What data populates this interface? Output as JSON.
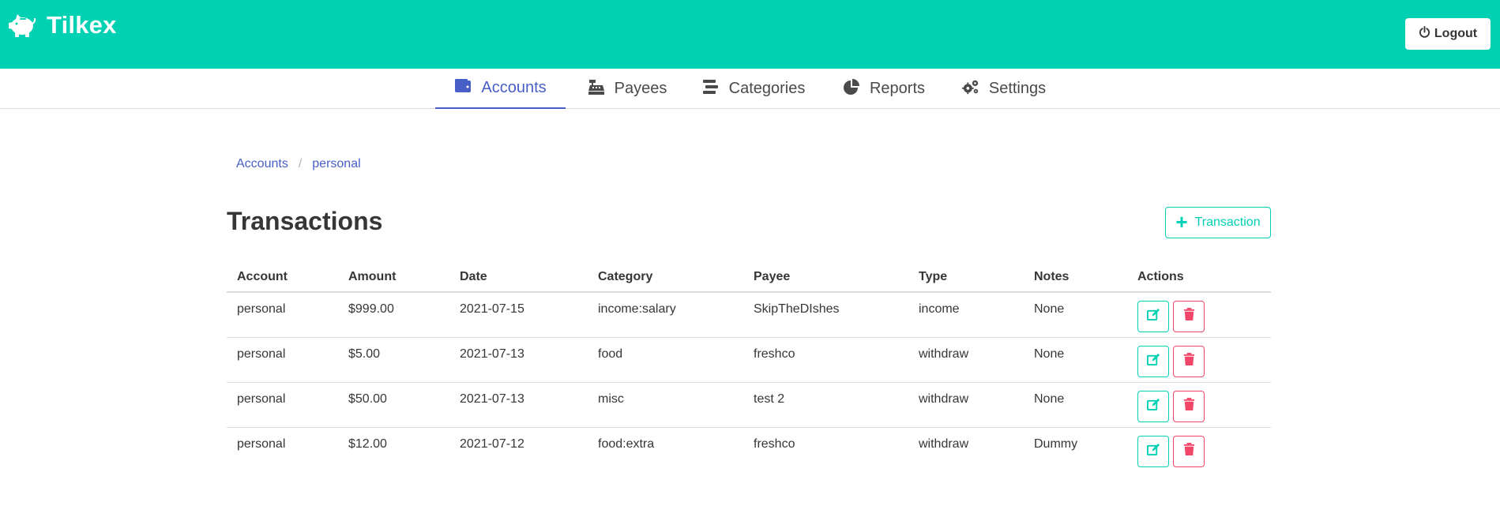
{
  "app": {
    "name": "Tilkex",
    "logo_icon": "piggy-bank-icon"
  },
  "header": {
    "logout_label": "Logout",
    "logout_icon": "power-icon"
  },
  "nav": {
    "tabs": [
      {
        "label": "Accounts",
        "icon": "wallet-icon",
        "active": true
      },
      {
        "label": "Payees",
        "icon": "cash-register-icon",
        "active": false
      },
      {
        "label": "Categories",
        "icon": "stream-icon",
        "active": false
      },
      {
        "label": "Reports",
        "icon": "chart-pie-icon",
        "active": false
      },
      {
        "label": "Settings",
        "icon": "cogs-icon",
        "active": false
      }
    ]
  },
  "breadcrumb": {
    "items": [
      "Accounts",
      "personal"
    ],
    "separator": "/"
  },
  "page": {
    "title": "Transactions",
    "add_button_label": "Transaction"
  },
  "table": {
    "columns": [
      "Account",
      "Amount",
      "Date",
      "Category",
      "Payee",
      "Type",
      "Notes",
      "Actions"
    ],
    "rows": [
      {
        "account": "personal",
        "amount": "$999.00",
        "date": "2021-07-15",
        "category": "income:salary",
        "payee": "SkipTheDIshes",
        "type": "income",
        "notes": "None"
      },
      {
        "account": "personal",
        "amount": "$5.00",
        "date": "2021-07-13",
        "category": "food",
        "payee": "freshco",
        "type": "withdraw",
        "notes": "None"
      },
      {
        "account": "personal",
        "amount": "$50.00",
        "date": "2021-07-13",
        "category": "misc",
        "payee": "test 2",
        "type": "withdraw",
        "notes": "None"
      },
      {
        "account": "personal",
        "amount": "$12.00",
        "date": "2021-07-12",
        "category": "food:extra",
        "payee": "freshco",
        "type": "withdraw",
        "notes": "Dummy"
      }
    ]
  },
  "colors": {
    "primary": "#00d1b2",
    "link": "#485fc7",
    "danger": "#f14668",
    "text": "#363636"
  }
}
